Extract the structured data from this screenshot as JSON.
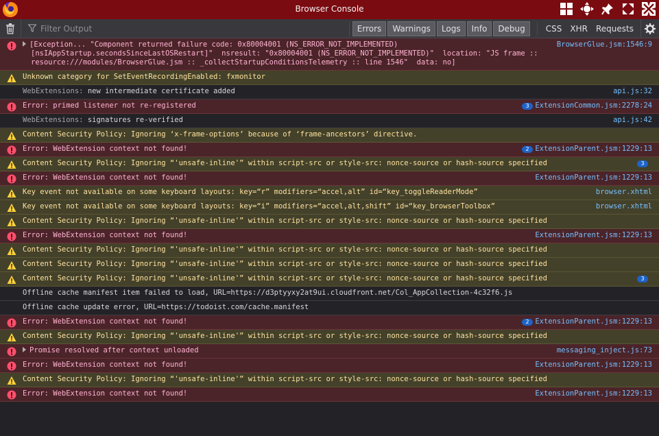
{
  "window": {
    "title": "Browser Console"
  },
  "toolbar": {
    "filter_placeholder": "Filter Output",
    "levels": [
      {
        "label": "Errors",
        "active": true
      },
      {
        "label": "Warnings",
        "active": true
      },
      {
        "label": "Logs",
        "active": true
      },
      {
        "label": "Info",
        "active": true
      },
      {
        "label": "Debug",
        "active": true
      }
    ],
    "types": [
      "CSS",
      "XHR",
      "Requests"
    ]
  },
  "colors": {
    "titlebar": "#7a0b10",
    "error": "#4b2429",
    "warning": "#44412a",
    "link": "#75bfff",
    "badge": "#1e63c7"
  },
  "messages": [
    {
      "level": "error",
      "twisty": true,
      "lines": [
        "[Exception... \"Component returned failure code: 0x80004001 (NS_ERROR_NOT_IMPLEMENTED)",
        "[nsIAppStartup.secondsSinceLastOSRestart]\"  nsresult: \"0x80004001 (NS_ERROR_NOT_IMPLEMENTED)\"  location: \"JS frame ::",
        "resource:///modules/BrowserGlue.jsm :: _collectStartupConditionsTelemetry :: line 1546\"  data: no]"
      ],
      "source": "BrowserGlue.jsm:1546:9"
    },
    {
      "level": "warn",
      "lines": [
        "Unknown category for SetEventRecordingEnabled: fxmonitor"
      ],
      "source": ""
    },
    {
      "level": "info",
      "prefix": "WebExtensions:",
      "lines": [
        "new intermediate certificate added"
      ],
      "source": "api.js:32"
    },
    {
      "level": "error",
      "lines": [
        "Error: primed listener not re-registered"
      ],
      "source": "ExtensionCommon.jsm:2278:24",
      "repeat": "3"
    },
    {
      "level": "info",
      "prefix": "WebExtensions:",
      "lines": [
        "signatures re-verified"
      ],
      "source": "api.js:42"
    },
    {
      "level": "warn",
      "lines": [
        "Content Security Policy: Ignoring ‘x-frame-options’ because of ‘frame-ancestors’ directive."
      ],
      "source": ""
    },
    {
      "level": "error",
      "lines": [
        "Error: WebExtension context not found!"
      ],
      "source": "ExtensionParent.jsm:1229:13",
      "repeat": "2"
    },
    {
      "level": "warn",
      "lines": [
        "Content Security Policy: Ignoring “'unsafe-inline'” within script-src or style-src: nonce-source or hash-source specified"
      ],
      "source": "",
      "repeat": "3"
    },
    {
      "level": "error",
      "lines": [
        "Error: WebExtension context not found!"
      ],
      "source": "ExtensionParent.jsm:1229:13"
    },
    {
      "level": "warn",
      "lines": [
        "Key event not available on some keyboard layouts: key=“r” modifiers=“accel,alt” id=“key_toggleReaderMode”"
      ],
      "source": "browser.xhtml"
    },
    {
      "level": "warn",
      "lines": [
        "Key event not available on some keyboard layouts: key=“i” modifiers=“accel,alt,shift” id=“key_browserToolbox”"
      ],
      "source": "browser.xhtml"
    },
    {
      "level": "warn",
      "lines": [
        "Content Security Policy: Ignoring “'unsafe-inline'” within script-src or style-src: nonce-source or hash-source specified"
      ],
      "source": ""
    },
    {
      "level": "error",
      "lines": [
        "Error: WebExtension context not found!"
      ],
      "source": "ExtensionParent.jsm:1229:13"
    },
    {
      "level": "warn",
      "lines": [
        "Content Security Policy: Ignoring “'unsafe-inline'” within script-src or style-src: nonce-source or hash-source specified"
      ],
      "source": ""
    },
    {
      "level": "warn",
      "lines": [
        "Content Security Policy: Ignoring “'unsafe-inline'” within script-src or style-src: nonce-source or hash-source specified"
      ],
      "source": ""
    },
    {
      "level": "warn",
      "lines": [
        "Content Security Policy: Ignoring “'unsafe-inline'” within script-src or style-src: nonce-source or hash-source specified"
      ],
      "source": "",
      "repeat": "3"
    },
    {
      "level": "info",
      "lines": [
        "Offline cache manifest item failed to load, URL=https://d3ptyyxy2at9ui.cloudfront.net/Col_AppCollection-4c32f6.js"
      ],
      "source": ""
    },
    {
      "level": "info",
      "lines": [
        "Offline cache update error, URL=https://todoist.com/cache.manifest"
      ],
      "source": ""
    },
    {
      "level": "error",
      "lines": [
        "Error: WebExtension context not found!"
      ],
      "source": "ExtensionParent.jsm:1229:13",
      "repeat": "2"
    },
    {
      "level": "warn",
      "lines": [
        "Content Security Policy: Ignoring “'unsafe-inline'” within script-src or style-src: nonce-source or hash-source specified"
      ],
      "source": ""
    },
    {
      "level": "error",
      "twisty": true,
      "lines": [
        "Promise resolved after context unloaded"
      ],
      "source": "messaging_inject.js:73"
    },
    {
      "level": "error",
      "lines": [
        "Error: WebExtension context not found!"
      ],
      "source": "ExtensionParent.jsm:1229:13"
    },
    {
      "level": "warn",
      "lines": [
        "Content Security Policy: Ignoring “'unsafe-inline'” within script-src or style-src: nonce-source or hash-source specified"
      ],
      "source": ""
    },
    {
      "level": "error",
      "lines": [
        "Error: WebExtension context not found!"
      ],
      "source": "ExtensionParent.jsm:1229:13"
    }
  ]
}
